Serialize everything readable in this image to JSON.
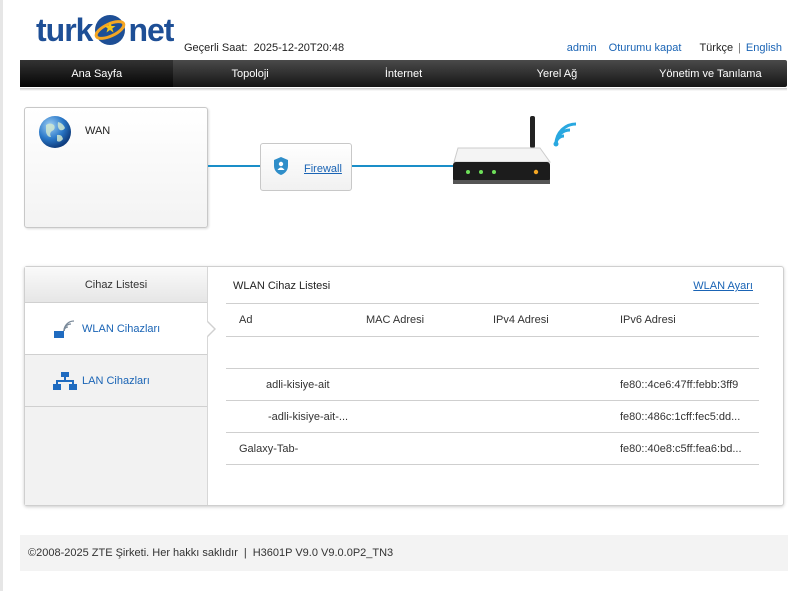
{
  "brand": {
    "part1": "turk",
    "part2": "net"
  },
  "header": {
    "clock_label": "Geçerli Saat:",
    "clock_value": "2025-12-20T20:48",
    "user": "admin",
    "logout": "Oturumu kapat",
    "lang_current": "Türkçe",
    "lang_sep": "|",
    "lang_alt": "English"
  },
  "nav": {
    "tabs": [
      {
        "label": "Ana Sayfa",
        "active": true
      },
      {
        "label": "Topoloji",
        "active": false
      },
      {
        "label": "İnternet",
        "active": false
      },
      {
        "label": "Yerel Ağ",
        "active": false
      },
      {
        "label": "Yönetim ve Tanılama",
        "active": false
      }
    ]
  },
  "topology": {
    "wan_label": "WAN",
    "firewall_label": "Firewall",
    "line_color": "#1a8ec8"
  },
  "devices": {
    "sidebar_title": "Cihaz Listesi",
    "sidebar_items": [
      {
        "label": "WLAN Cihazları",
        "icon": "wlan-icon",
        "active": true
      },
      {
        "label": "LAN Cihazları",
        "icon": "lan-icon",
        "active": false
      }
    ],
    "content_title": "WLAN Cihaz Listesi",
    "settings_link": "WLAN Ayarı",
    "columns": [
      "Ad",
      "MAC Adresi",
      "IPv4 Adresi",
      "IPv6 Adresi"
    ],
    "rows": [
      {
        "name": "",
        "mac": "",
        "ipv4": "",
        "ipv6": ""
      },
      {
        "name": "adli-kisiye-ait",
        "mac": "",
        "ipv4": "",
        "ipv6": "fe80::4ce6:47ff:febb:3ff9"
      },
      {
        "name": "-adli-kisiye-ait-...",
        "mac": "",
        "ipv4": "",
        "ipv6": "fe80::486c:1cff:fec5:dd..."
      },
      {
        "name": "Galaxy-Tab-",
        "mac": "",
        "ipv4": "",
        "ipv6": "fe80::40e8:c5ff:fea6:bd..."
      }
    ]
  },
  "footer": {
    "copyright": "©2008-2025 ZTE Şirketi. Her hakkı saklıdır",
    "sep": "|",
    "version": "H3601P V9.0 V9.0.0P2_TN3"
  },
  "colors": {
    "brand_blue": "#1e4f96",
    "link_blue": "#1a64b5",
    "accent_orange": "#f5a623"
  }
}
